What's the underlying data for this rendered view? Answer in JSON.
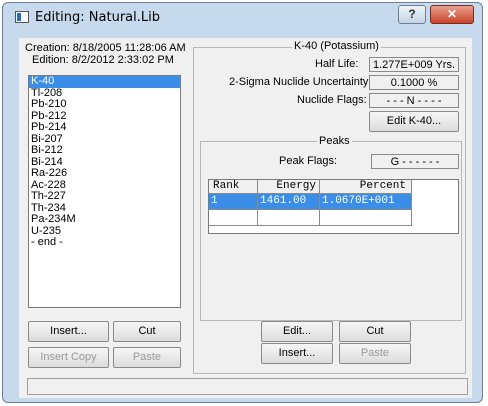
{
  "window": {
    "title": "Editing: Natural.Lib",
    "help_label": "?",
    "close_label": "✕"
  },
  "library": {
    "creation": "Creation: 8/18/2005  11:28:06 AM",
    "edition": "Edition: 8/2/2012  2:33:02 PM"
  },
  "nuclides": [
    "K-40",
    "Tl-208",
    "Pb-210",
    "Pb-212",
    "Pb-214",
    "Bi-207",
    "Bi-212",
    "Bi-214",
    "Ra-226",
    "Ac-228",
    "Th-227",
    "Th-234",
    "Pa-234M",
    "U-235",
    "- end -"
  ],
  "nuclide_buttons": {
    "insert": "Insert...",
    "cut": "Cut",
    "insert_copy": "Insert Copy",
    "paste": "Paste"
  },
  "nuclide_panel": {
    "title": "K-40 (Potassium)",
    "half_life_label": "Half Life:",
    "half_life_value": "1.277E+009 Yrs.",
    "uncertainty_label": "2-Sigma Nuclide Uncertainty:",
    "uncertainty_value": "0.1000 %",
    "flags_label": "Nuclide Flags:",
    "flags_value": "- - - N - - - -",
    "edit_button": "Edit K-40..."
  },
  "peaks": {
    "title": "Peaks",
    "flags_label": "Peak Flags:",
    "flags_value": "G - - - - - -",
    "columns": [
      "Rank",
      "Energy",
      "Percent"
    ],
    "rows": [
      {
        "rank": "1",
        "energy": "1461.00",
        "percent": "1.0670E+001"
      }
    ],
    "edit_button": "Edit...",
    "cut_button": "Cut",
    "insert_button": "Insert...",
    "paste_button": "Paste"
  },
  "status": ""
}
